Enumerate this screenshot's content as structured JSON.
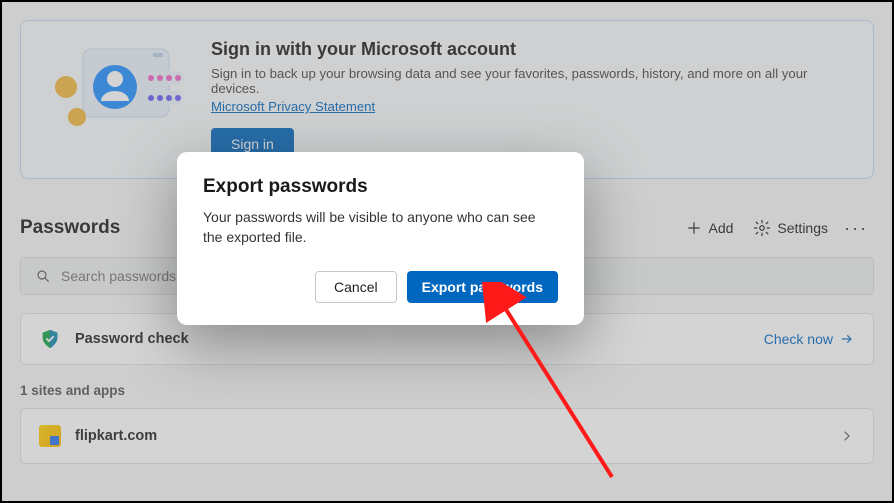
{
  "banner": {
    "title": "Sign in with your Microsoft account",
    "desc": "Sign in to back up your browsing data and see your favorites, passwords, history, and more on all your devices.",
    "privacy_link": "Microsoft Privacy Statement",
    "signin_label": "Sign in"
  },
  "header": {
    "title": "Passwords",
    "add_label": "Add",
    "settings_label": "Settings"
  },
  "search": {
    "placeholder": "Search passwords"
  },
  "password_check": {
    "label": "Password check",
    "action": "Check now"
  },
  "sites": {
    "count_label": "1 sites and apps",
    "items": [
      {
        "name": "flipkart.com"
      }
    ]
  },
  "modal": {
    "title": "Export passwords",
    "body": "Your passwords will be visible to anyone who can see the exported file.",
    "cancel": "Cancel",
    "confirm": "Export passwords"
  }
}
